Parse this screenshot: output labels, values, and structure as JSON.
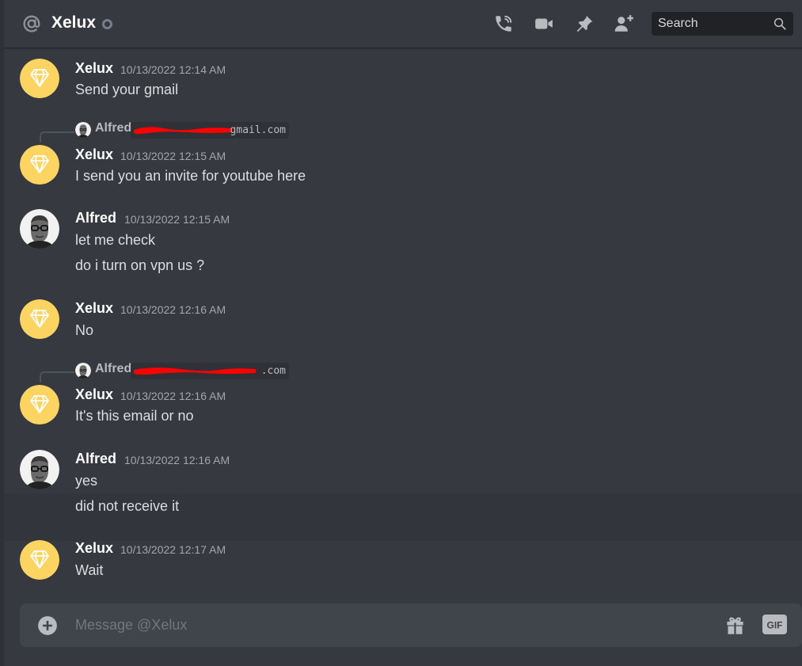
{
  "header": {
    "title": "Xelux",
    "search_placeholder": "Search",
    "icons": [
      "at-icon",
      "status-offline-icon",
      "voice-call-icon",
      "video-call-icon",
      "pin-icon",
      "add-friend-icon",
      "search-icon"
    ]
  },
  "messages": [
    {
      "author": "Xelux",
      "timestamp": "10/13/2022 12:14 AM",
      "lines": [
        "Send your gmail"
      ]
    },
    {
      "author": "Xelux",
      "timestamp": "10/13/2022 12:15 AM",
      "lines": [
        "I send you an invite for youtube here"
      ],
      "reply": {
        "author": "Alfred",
        "snippet_visible": "gmail.com"
      }
    },
    {
      "author": "Alfred",
      "timestamp": "10/13/2022 12:15 AM",
      "lines": [
        "let me check",
        "do i turn on vpn us ?"
      ]
    },
    {
      "author": "Xelux",
      "timestamp": "10/13/2022 12:16 AM",
      "lines": [
        "No"
      ]
    },
    {
      "author": "Xelux",
      "timestamp": "10/13/2022 12:16 AM",
      "lines": [
        "It's this email or no"
      ],
      "reply": {
        "author": "Alfred",
        "snippet_visible": ".com"
      }
    },
    {
      "author": "Alfred",
      "timestamp": "10/13/2022 12:16 AM",
      "lines": [
        "yes",
        "did not receive it"
      ]
    },
    {
      "author": "Xelux",
      "timestamp": "10/13/2022 12:17 AM",
      "lines": [
        "Wait"
      ]
    }
  ],
  "composer": {
    "placeholder": "Message @Xelux",
    "icons": [
      "add-attachment-icon",
      "gift-icon",
      "gif-icon"
    ]
  },
  "colors": {
    "background": "#36393f",
    "header_border": "#26282c",
    "composer_bg": "#40444b",
    "search_bg": "#202225",
    "xelux_avatar": "#fcd462",
    "redaction": "#ff0000"
  }
}
